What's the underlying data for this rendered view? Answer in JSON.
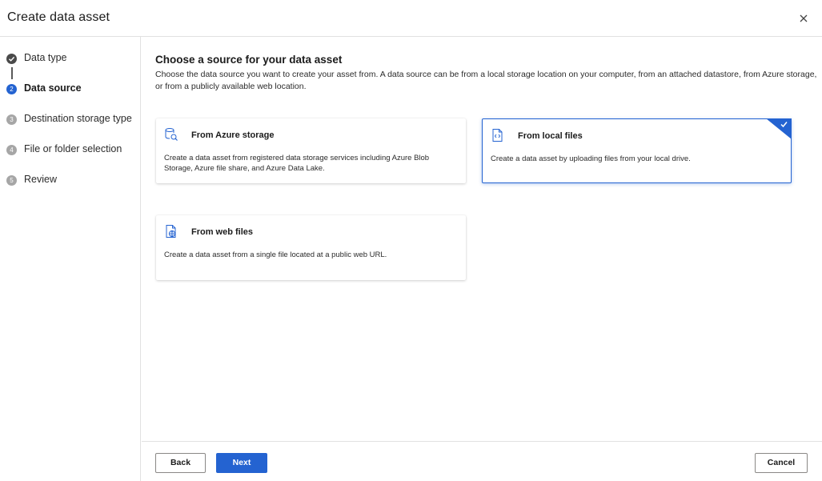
{
  "header": {
    "title": "Create data asset",
    "close_icon": "close-icon"
  },
  "steps": [
    {
      "label": "Data type",
      "state": "done",
      "number": "✓"
    },
    {
      "label": "Data source",
      "state": "active",
      "number": "2"
    },
    {
      "label": "Destination storage type",
      "state": "pending",
      "number": "3"
    },
    {
      "label": "File or folder selection",
      "state": "pending",
      "number": "4"
    },
    {
      "label": "Review",
      "state": "pending",
      "number": "5"
    }
  ],
  "main": {
    "heading": "Choose a source for your data asset",
    "description": "Choose the data source you want to create your asset from. A data source can be from a local storage location on your computer, from an attached datastore, from Azure storage, or from a publicly available web location."
  },
  "cards": [
    {
      "title": "From Azure storage",
      "description": "Create a data asset from registered data storage services including Azure Blob Storage, Azure file share, and Azure Data Lake.",
      "icon": "database-search-icon",
      "selected": false
    },
    {
      "title": "From local files",
      "description": "Create a data asset by uploading files from your local drive.",
      "icon": "code-file-icon",
      "selected": true
    },
    {
      "title": "From web files",
      "description": "Create a data asset from a single file located at a public web URL.",
      "icon": "web-file-icon",
      "selected": false
    }
  ],
  "footer": {
    "back_label": "Back",
    "next_label": "Next",
    "cancel_label": "Cancel"
  },
  "colors": {
    "accent": "#2463d1",
    "border": "#e1e1e1"
  }
}
